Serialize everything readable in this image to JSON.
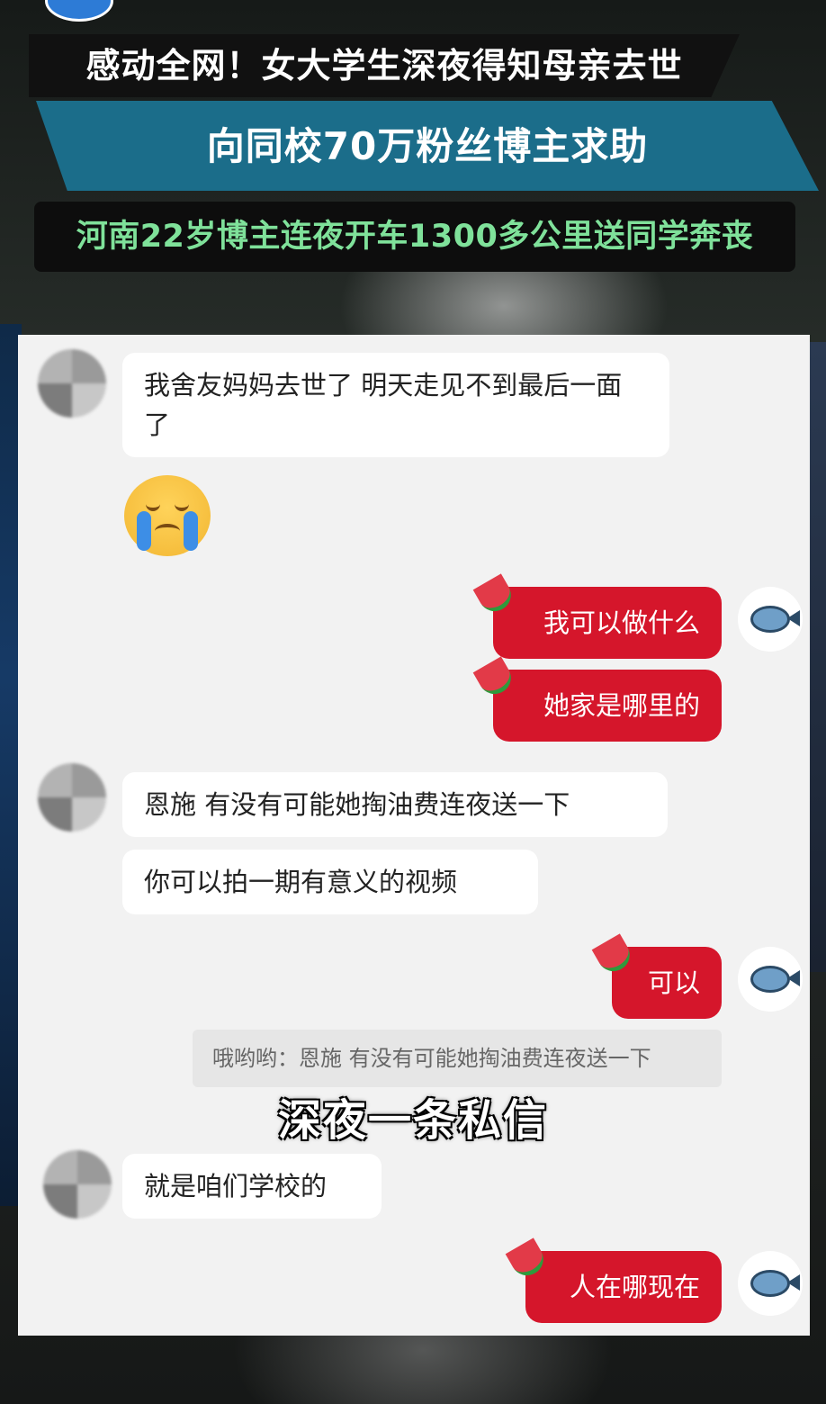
{
  "headline": {
    "line1": "感动全网！女大学生深夜得知母亲去世",
    "line2": "向同校70万粉丝博主求助",
    "line3": "河南22岁博主连夜开车1300多公里送同学奔丧"
  },
  "chat": {
    "messages": [
      {
        "from": "other",
        "text": "我舍友妈妈去世了 明天走见不到最后一面了"
      },
      {
        "from": "other",
        "emoji": "loudly-crying-face"
      },
      {
        "from": "me",
        "text": "我可以做什么"
      },
      {
        "from": "me",
        "text": "她家是哪里的"
      },
      {
        "from": "other",
        "text": "恩施 有没有可能她掏油费连夜送一下"
      },
      {
        "from": "other",
        "text": "你可以拍一期有意义的视频"
      },
      {
        "from": "me",
        "text": "可以"
      },
      {
        "from": "me",
        "quote": "哦哟哟：恩施 有没有可能她掏油费连夜送一下"
      },
      {
        "from": "other",
        "text": "就是咱们学校的"
      },
      {
        "from": "me",
        "text": "人在哪现在"
      }
    ]
  },
  "caption": "深夜一条私信",
  "colors": {
    "outgoing_bubble": "#d5162b",
    "incoming_bubble": "#ffffff",
    "title_band": "#1b6d8a",
    "subtitle_green": "#7fe19a"
  }
}
